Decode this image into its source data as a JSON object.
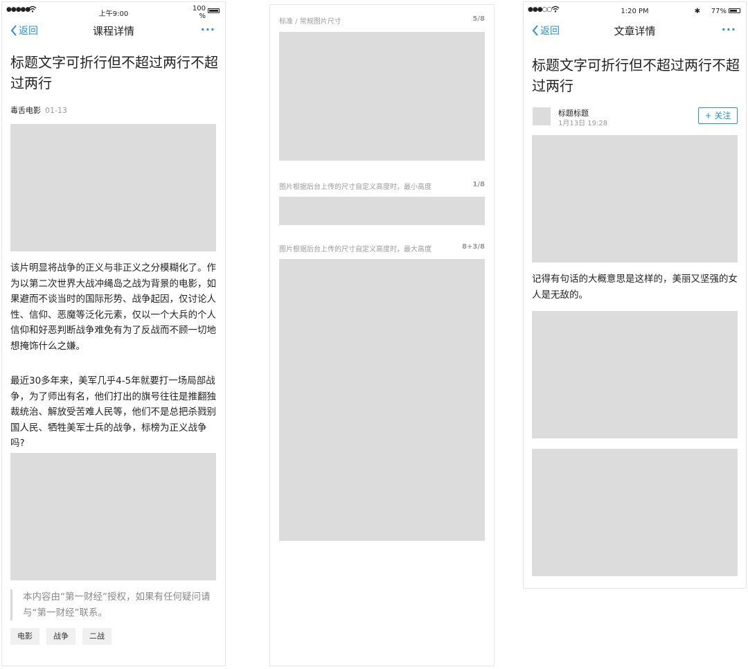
{
  "left_screen": {
    "status": {
      "signal": "●●●●● ",
      "time": "上午9:00",
      "battery": "100\n%"
    },
    "nav": {
      "back": "返回",
      "title": "课程详情",
      "more": "···"
    },
    "headline": "标题文字可折行但不超过两行不超过两行",
    "source": "毒舌电影",
    "date": "01-13",
    "paragraph1": "该片明显将战争的正义与非正义之分模糊化了。作为以第二次世界大战冲绳岛之战为背景的电影，如果避而不谈当时的国际形势、战争起因，仅讨论人性、信仰、恶魔等泛化元素，仅以一个大兵的个人信仰和好恶判断战争难免有为了反战而不顾一切地想掩饰什么之嫌。",
    "paragraph2": "最近30多年来，美军几乎4-5年就要打一场局部战争，为了师出有名，他们打出的旗号往往是推翻独裁统治、解放受苦难人民等，他们不是总把杀戮别国人民、牺牲美军士兵的战争，标榜为正义战争吗?",
    "copyright": "本内容由“第一财经”授权，如果有任何疑问请与“第一财经”联系。",
    "tags": [
      "电影",
      "战争",
      "二战"
    ]
  },
  "middle_screen": {
    "sections": [
      {
        "caption": "标准 / 常规图片尺寸",
        "counter": "5/8"
      },
      {
        "caption": "图片根据后台上传的尺寸自定义高度时，最小高度",
        "counter": "1/8"
      },
      {
        "caption": "图片根据后台上传的尺寸自定义高度时，最大高度",
        "counter": "8+3/8"
      }
    ]
  },
  "right_screen": {
    "status": {
      "signal": "●●●○○",
      "time": "1:20 PM",
      "battery": "77%"
    },
    "nav": {
      "back": "返回",
      "title": "文章详情",
      "more": "···"
    },
    "headline": "标题文字可折行但不超过两行不超过两行",
    "author": {
      "name": "标题标题",
      "date": "1月13日  19:28"
    },
    "follow": "+ 关注",
    "paragraph": "记得有句话的大概意思是这样的，美丽又坚强的女人是无敌的。"
  },
  "colors": {
    "accent": "#1e8ff0",
    "placeholder": "#dcdcdc",
    "muted": "#999999"
  },
  "icons": [
    "wifi-icon",
    "battery-icon",
    "chevron-left-icon",
    "more-icon",
    "bluetooth-icon"
  ]
}
